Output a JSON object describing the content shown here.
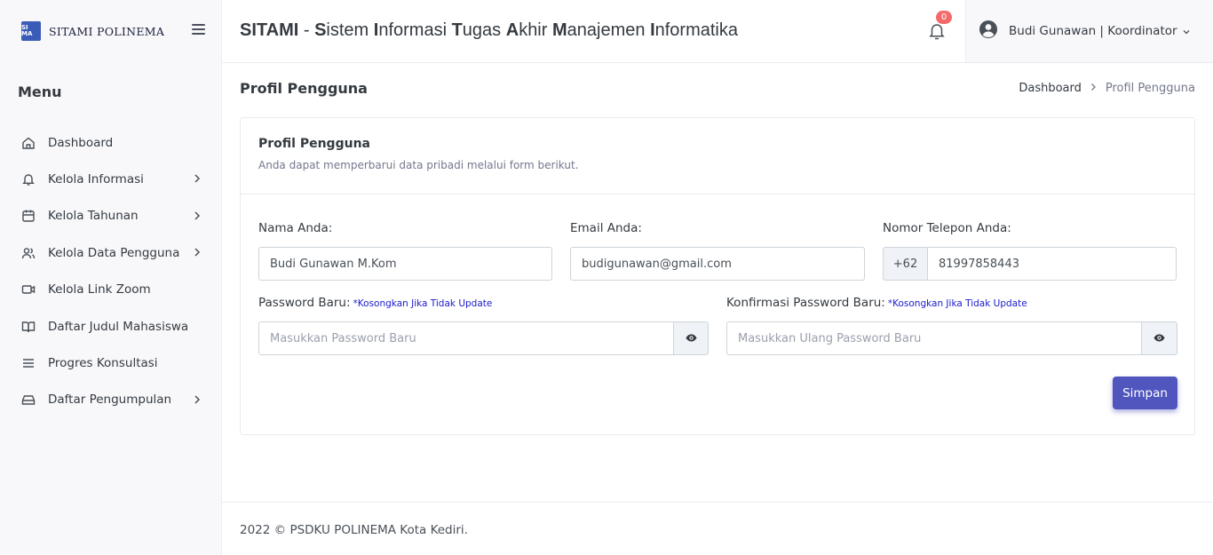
{
  "brand": {
    "logo_text": "SI MA",
    "name": "SITAMI POLINEMA"
  },
  "sidebar": {
    "menu_title": "Menu",
    "items": [
      {
        "label": "Dashboard",
        "icon": "home-icon",
        "has_submenu": false
      },
      {
        "label": "Kelola Informasi",
        "icon": "bell-icon",
        "has_submenu": true
      },
      {
        "label": "Kelola Tahunan",
        "icon": "calendar-icon",
        "has_submenu": true
      },
      {
        "label": "Kelola Data Pengguna",
        "icon": "users-icon",
        "has_submenu": true
      },
      {
        "label": "Kelola Link Zoom",
        "icon": "video-icon",
        "has_submenu": false
      },
      {
        "label": "Daftar Judul Mahasiswa",
        "icon": "book-open-icon",
        "has_submenu": false
      },
      {
        "label": "Progres Konsultasi",
        "icon": "list-icon",
        "has_submenu": false
      },
      {
        "label": "Daftar Pengumpulan",
        "icon": "inbox-icon",
        "has_submenu": true
      }
    ]
  },
  "header": {
    "title_parts": [
      {
        "b": "SITAMI",
        "r": ""
      },
      {
        "b": "",
        "r": " - "
      },
      {
        "b": "S",
        "r": "istem "
      },
      {
        "b": "I",
        "r": "nformasi "
      },
      {
        "b": "T",
        "r": "ugas "
      },
      {
        "b": "A",
        "r": "khir "
      },
      {
        "b": "M",
        "r": "anajemen "
      },
      {
        "b": "I",
        "r": "nformatika"
      }
    ],
    "notification_count": "0",
    "user_label": "Budi Gunawan | Koordinator"
  },
  "page": {
    "title": "Profil Pengguna",
    "breadcrumb": {
      "home": "Dashboard",
      "current": "Profil Pengguna"
    }
  },
  "card": {
    "title": "Profil Pengguna",
    "subtitle": "Anda dapat memperbarui data pribadi melalui form berikut.",
    "name_label": "Nama Anda:",
    "name_value": "Budi Gunawan M.Kom",
    "email_label": "Email Anda:",
    "email_value": "budigunawan@gmail.com",
    "phone_label": "Nomor Telepon Anda:",
    "phone_prefix": "+62",
    "phone_value": "81997858443",
    "password_label": "Password Baru:",
    "password_note": "*Kosongkan Jika Tidak Update",
    "password_placeholder": "Masukkan Password Baru",
    "confirm_label": "Konfirmasi Password Baru:",
    "confirm_note": "*Kosongkan Jika Tidak Update",
    "confirm_placeholder": "Masukkan Ulang Password Baru",
    "save_label": "Simpan"
  },
  "footer": {
    "text": "2022 © PSDKU POLINEMA Kota Kediri."
  },
  "colors": {
    "primary": "#5156be",
    "badge": "#f46a6a",
    "note": "#1a1acc",
    "sidebar_bg": "#f8f8fb"
  }
}
